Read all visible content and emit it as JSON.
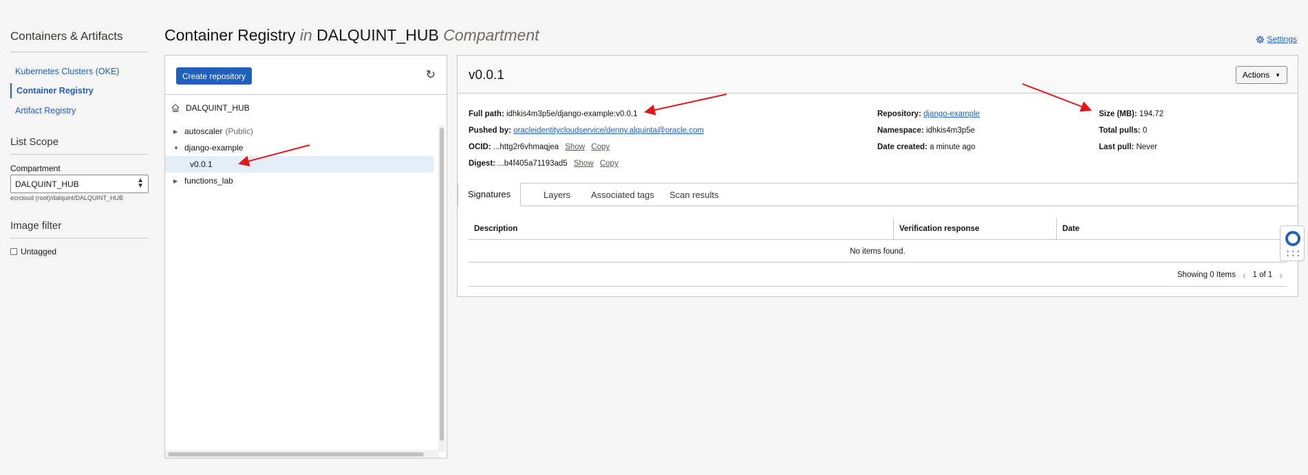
{
  "nav": {
    "title": "Containers & Artifacts",
    "items": [
      {
        "label": "Kubernetes Clusters (OKE)",
        "active": false
      },
      {
        "label": "Container Registry",
        "active": true
      },
      {
        "label": "Artifact Registry",
        "active": false
      }
    ],
    "list_scope_title": "List Scope",
    "compartment_label": "Compartment",
    "compartment_value": "DALQUINT_HUB",
    "compartment_path": "ecrcloud (root)/dalquint/DALQUINT_HUB",
    "image_filter_title": "Image filter",
    "untagged_label": "Untagged"
  },
  "header": {
    "title_main": "Container Registry",
    "title_in": "in",
    "title_compartment": "DALQUINT_HUB",
    "title_suffix": "Compartment",
    "settings_label": "Settings"
  },
  "tree": {
    "create_button": "Create repository",
    "root_label": "DALQUINT_HUB",
    "repos": {
      "autoscaler": {
        "name": "autoscaler",
        "tag": "(Public)"
      },
      "django": {
        "name": "django-example"
      },
      "version": {
        "name": "v0.0.1"
      },
      "functions": {
        "name": "functions_lab"
      }
    }
  },
  "details": {
    "title": "v0.0.1",
    "actions_label": "Actions",
    "full_path_label": "Full path:",
    "full_path_value": "idhkis4m3p5e/django-example:v0.0.1",
    "pushed_by_label": "Pushed by:",
    "pushed_by_value": "oracleidentitycloudservice/denny.alquinta@oracle.com",
    "ocid_label": "OCID:",
    "ocid_value": "...httg2r6vhmaqjea",
    "digest_label": "Digest:",
    "digest_value": "...b4f405a71193ad5",
    "show_label": "Show",
    "copy_label": "Copy",
    "repository_label": "Repository:",
    "repository_value": "django-example",
    "namespace_label": "Namespace:",
    "namespace_value": "idhkis4m3p5e",
    "date_created_label": "Date created:",
    "date_created_value": "a minute ago",
    "size_label": "Size (MB):",
    "size_value": "194.72",
    "total_pulls_label": "Total pulls:",
    "total_pulls_value": "0",
    "last_pull_label": "Last pull:",
    "last_pull_value": "Never",
    "tabs": [
      "Signatures",
      "Layers",
      "Associated tags",
      "Scan results"
    ],
    "table": {
      "columns": [
        "Description",
        "Verification response",
        "Date"
      ],
      "empty_message": "No items found.",
      "showing": "Showing 0 Items",
      "page": "1 of 1"
    }
  },
  "colors": {
    "accent": "#1f5fbf",
    "annotation_arrow": "#e8141b",
    "selected_row": "#e4eef9"
  }
}
